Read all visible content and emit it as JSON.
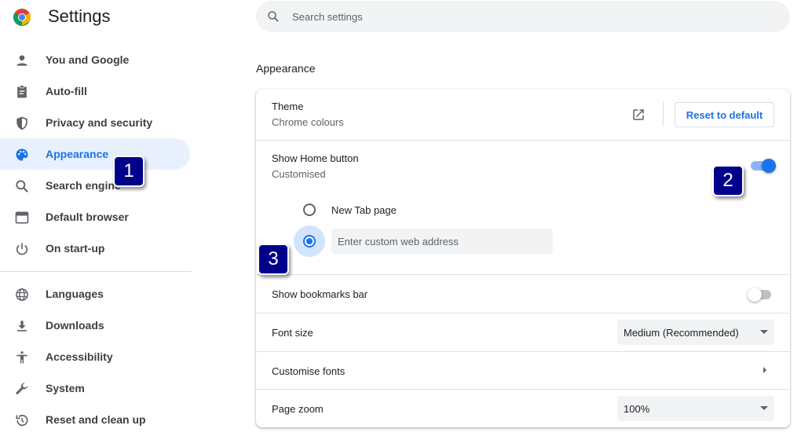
{
  "header": {
    "title": "Settings",
    "search_placeholder": "Search settings"
  },
  "sidebar": {
    "items": [
      {
        "label": "You and Google",
        "icon": "person-icon"
      },
      {
        "label": "Auto-fill",
        "icon": "clipboard-icon"
      },
      {
        "label": "Privacy and security",
        "icon": "shield-icon"
      },
      {
        "label": "Appearance",
        "icon": "palette-icon",
        "active": true
      },
      {
        "label": "Search engine",
        "icon": "search-icon"
      },
      {
        "label": "Default browser",
        "icon": "browser-window-icon"
      },
      {
        "label": "On start-up",
        "icon": "power-icon"
      },
      {
        "label": "Languages",
        "icon": "globe-icon"
      },
      {
        "label": "Downloads",
        "icon": "download-icon"
      },
      {
        "label": "Accessibility",
        "icon": "accessibility-icon"
      },
      {
        "label": "System",
        "icon": "wrench-icon"
      },
      {
        "label": "Reset and clean up",
        "icon": "history-icon"
      }
    ]
  },
  "main": {
    "section_title": "Appearance",
    "theme": {
      "label": "Theme",
      "sub": "Chrome colours",
      "reset_label": "Reset to default"
    },
    "home_button": {
      "label": "Show Home button",
      "sub": "Customised",
      "enabled": true,
      "option_new_tab": "New Tab page",
      "custom_placeholder": "Enter custom web address",
      "selected_option": "custom"
    },
    "bookmarks_bar": {
      "label": "Show bookmarks bar",
      "enabled": false
    },
    "font_size": {
      "label": "Font size",
      "value": "Medium (Recommended)"
    },
    "customise_fonts": {
      "label": "Customise fonts"
    },
    "page_zoom": {
      "label": "Page zoom",
      "value": "100%"
    }
  },
  "callouts": [
    "1",
    "2",
    "3"
  ],
  "colors": {
    "accent": "#1a73e8",
    "active_nav_bg": "#e8f0fe",
    "callout_bg": "#00008b"
  }
}
